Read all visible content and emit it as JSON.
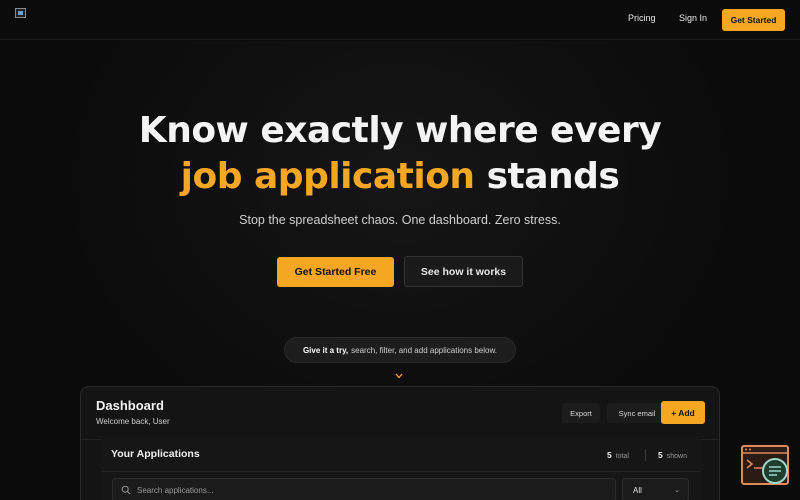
{
  "nav": {
    "pricing": "Pricing",
    "sign_in": "Sign In",
    "get_started": "Get Started"
  },
  "hero": {
    "headline_line1": "Know exactly where every",
    "headline_accent": "job application",
    "headline_line2_rest": " stands",
    "subtitle": "Stop the spreadsheet chaos. One dashboard. Zero stress.",
    "primary_cta": "Get Started Free",
    "secondary_cta": "See how it works",
    "try_prompt_bold": "Give it a try,",
    "try_prompt_rest": "search, filter, and add applications below."
  },
  "dashboard": {
    "title": "Dashboard",
    "welcome": "Welcome back, User",
    "export_label": "Export",
    "sync_label": "Sync email",
    "add_label": "+ Add",
    "apps": {
      "title": "Your Applications",
      "total_count": "5",
      "total_label": "total",
      "shown_count": "5",
      "shown_label": "shown",
      "search_placeholder": "Search applications...",
      "filter_value": "All"
    }
  },
  "icons": {
    "logo": "broken-image-logo",
    "chevron": "chevron-down-icon",
    "search": "search-icon",
    "widget": "chat-widget-icon"
  },
  "colors": {
    "accent": "#f5a623",
    "background": "#0b0b0b",
    "panel": "#141414"
  }
}
